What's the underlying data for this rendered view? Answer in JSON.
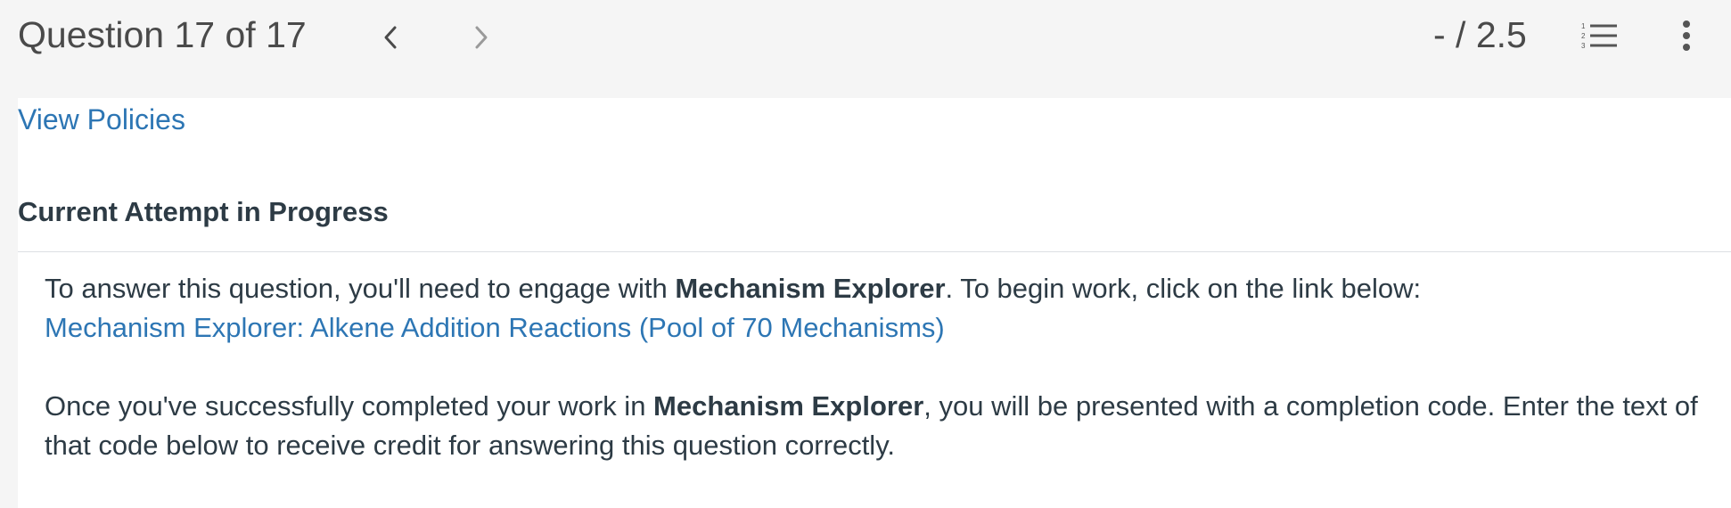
{
  "header": {
    "question_counter": "Question 17 of 17",
    "score": "- / 2.5",
    "prev_icon": "chevron-left-icon",
    "next_icon": "chevron-right-icon",
    "list_icon": "numbered-list-icon",
    "more_icon": "vertical-ellipsis-icon"
  },
  "content": {
    "policies_link": "View Policies",
    "attempt_heading": "Current Attempt in Progress",
    "intro_prefix": "To answer this question, you'll need to engage with ",
    "intro_bold": "Mechanism Explorer",
    "intro_suffix": ". To begin work, click on the link below:",
    "mechanism_link": "Mechanism Explorer: Alkene Addition Reactions (Pool of 70 Mechanisms)",
    "completion_prefix": "Once you've successfully completed your work in ",
    "completion_bold": "Mechanism Explorer",
    "completion_suffix": ", you will be presented with a completion code. Enter the text of that code below to receive credit for answering this question correctly."
  },
  "colors": {
    "link": "#2d76b4",
    "text": "#2d3b45",
    "header_bg": "#f5f5f5",
    "content_bg": "#ffffff"
  }
}
